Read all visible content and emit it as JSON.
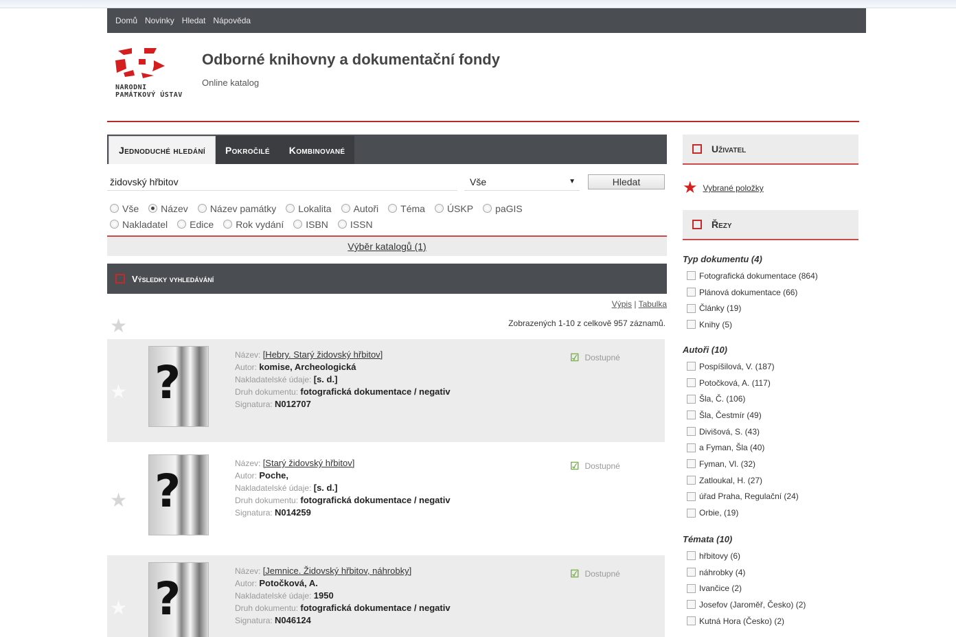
{
  "nav": {
    "items": [
      "Domů",
      "Novinky",
      "Hledat",
      "Nápověda"
    ]
  },
  "header": {
    "logo_text": "NÁRODNÍ PAMÁTKOVÝ ÚSTAV",
    "title": "Odborné knihovny a dokumentační fondy",
    "subtitle": "Online katalog"
  },
  "tabs": [
    "Jednoduché hledání",
    "Pokročilé",
    "Kombinované"
  ],
  "search": {
    "query": "židovský hřbitov",
    "scope": "Vše",
    "button": "Hledat"
  },
  "radios": {
    "line1": [
      "Vše",
      "Název",
      "Název památky",
      "Lokalita",
      "Autoři",
      "Téma",
      "ÚSKP",
      "paGIS"
    ],
    "line2": [
      "Nakladatel",
      "Edice",
      "Rok vydání",
      "ISBN",
      "ISSN"
    ],
    "selected": "Název"
  },
  "catalog_link": "Výběr katalogů (1)",
  "results": {
    "title": "Výsledky vyhledávání",
    "view_list": "Výpis",
    "view_sep": "|",
    "view_table": "Tabulka",
    "count_text": "Zobrazených 1-10 z celkově 957 záznamů.",
    "labels": {
      "name": "Název",
      "author": "Autor",
      "publisher": "Nakladatelské údaje",
      "doctype": "Druh dokumentu",
      "signature": "Signatura"
    },
    "items": [
      {
        "name": "[Hebry. Starý židovský hřbitov]",
        "author": "komise, Archeologická",
        "publisher": "[s. d.]",
        "doctype": "fotografická dokumentace / negativ",
        "signature": "N012707",
        "status": "Dostupné"
      },
      {
        "name": "[Starý židovský hřbitov]",
        "author": "Poche,",
        "publisher": "[s. d.]",
        "doctype": "fotografická dokumentace / negativ",
        "signature": "N014259",
        "status": "Dostupné"
      },
      {
        "name": "[Jemnice. Židovský hřbitov, náhrobky]",
        "author": "Potočková, A.",
        "publisher": "1950",
        "doctype": "fotografická dokumentace / negativ",
        "signature": "N046124",
        "status": "Dostupné"
      }
    ]
  },
  "sidebar": {
    "user_title": "Uživatel",
    "favorites_link": "Vybrané položky",
    "facets_title": "Řezy",
    "facets": [
      {
        "title": "Typ dokumentu (4)",
        "items": [
          "Fotografická dokumentace (864)",
          "Plánová dokumentace (66)",
          "Články (19)",
          "Knihy (5)"
        ]
      },
      {
        "title": "Autoři (10)",
        "items": [
          "Pospíšilová, V. (187)",
          "Potočková, A. (117)",
          "Šla, Č. (106)",
          "Šla, Čestmír (49)",
          "Divišová, S. (43)",
          "a Fyman, Šla (40)",
          "Fyman, Vl. (32)",
          "Zatloukal, H. (27)",
          "úřad Praha, Regulační (24)",
          "Orbie, (19)"
        ]
      },
      {
        "title": "Témata (10)",
        "items": [
          "hřbitovy (6)",
          "náhrobky (4)",
          "Ivančice (2)",
          "Josefov (Jaroměř, Česko) (2)",
          "Kutná Hora (Česko) (2)"
        ]
      }
    ]
  },
  "colors": {
    "accent_red": "#c32a2a",
    "dark_bar": "#4a4d52",
    "available_green": "#7bb24d"
  }
}
